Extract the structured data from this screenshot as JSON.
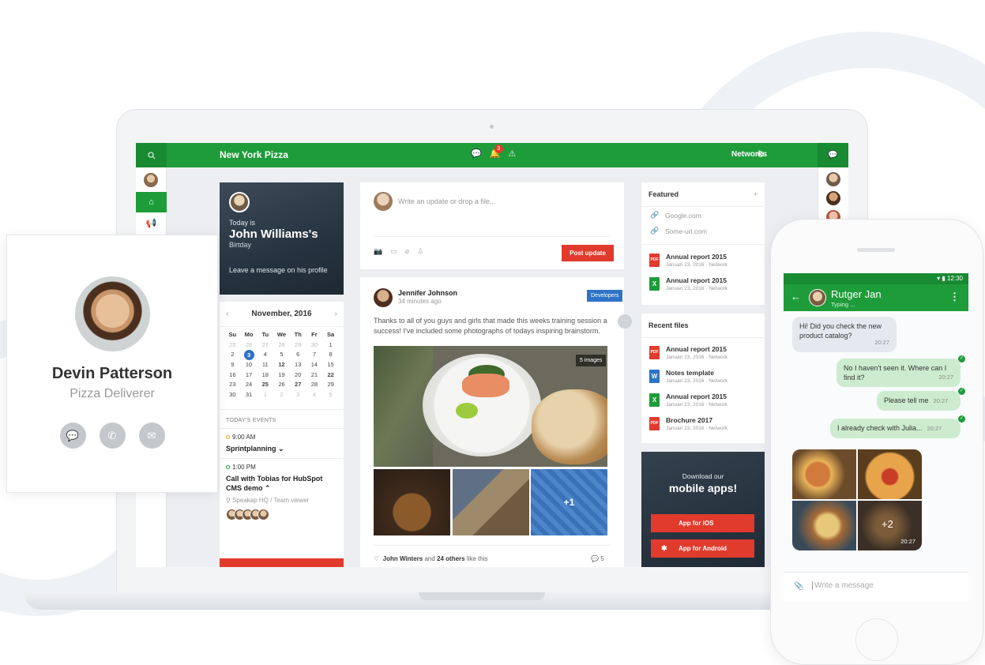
{
  "app": {
    "title": "New York Pizza",
    "notification_count": "3",
    "networks_label": "Networks"
  },
  "birthday": {
    "today_is": "Today is",
    "name": "John Williams's",
    "occasion": "Birtday",
    "cta": "Leave a message on his profile"
  },
  "calendar": {
    "month": "November, 2016",
    "weekdays": [
      "Su",
      "Mo",
      "Tu",
      "We",
      "Th",
      "Fr",
      "Sa"
    ],
    "weeks": [
      [
        "25",
        "26",
        "27",
        "28",
        "29",
        "30",
        "1"
      ],
      [
        "2",
        "3",
        "4",
        "5",
        "6",
        "7",
        "8"
      ],
      [
        "9",
        "10",
        "11",
        "12",
        "13",
        "14",
        "15"
      ],
      [
        "16",
        "17",
        "18",
        "19",
        "20",
        "21",
        "22"
      ],
      [
        "23",
        "24",
        "25",
        "26",
        "27",
        "28",
        "29"
      ],
      [
        "30",
        "31",
        "1",
        "2",
        "3",
        "4",
        "5"
      ]
    ],
    "selected_day": "3"
  },
  "events": {
    "heading": "TODAY'S EVENTS",
    "items": [
      {
        "time": "9:00 AM",
        "title": "Sprintplanning ⌄"
      },
      {
        "time": "1:00 PM",
        "title": "Call with Tobias for HubSpot CMS demo ⌃",
        "location": "Speakap HQ / Team viewer"
      }
    ]
  },
  "composer": {
    "placeholder": "Write an update or drop a file...",
    "post_label": "Post update"
  },
  "post": {
    "author": "Jennifer Johnson",
    "time": "34 minutes ago",
    "badge": "Developers",
    "text": "Thanks to all of you guys and girls that made this weeks training session a success! I've included some photographs of todays inspiring brainstorm.",
    "image_count": "5 images",
    "more_images": "+1",
    "like_name": "John Winters",
    "like_mid": " and ",
    "like_others": "24 others",
    "like_suffix": " like this",
    "comments": "5"
  },
  "featured": {
    "title": "Featured",
    "links": [
      "Google.com",
      "Some-url.com"
    ],
    "files": [
      {
        "name": "Annual report 2015",
        "meta": "Januari 23, 2016 · Network",
        "type": "PDF",
        "color": "#e03b2d"
      },
      {
        "name": "Annual report 2015",
        "meta": "Januari 23, 2016 · Network",
        "type": "X",
        "color": "#1e9c3a"
      }
    ]
  },
  "recent": {
    "title": "Recent files",
    "files": [
      {
        "name": "Annual report 2015",
        "meta": "Januari 23, 2016 · Network",
        "type": "PDF",
        "color": "#e03b2d"
      },
      {
        "name": "Notes template",
        "meta": "Januari 23, 2016 · Network",
        "type": "W",
        "color": "#2f73c6"
      },
      {
        "name": "Annual report 2015",
        "meta": "Januari 23, 2016 · Network",
        "type": "X",
        "color": "#1e9c3a"
      },
      {
        "name": "Brochure 2017",
        "meta": "Januari 23, 2016 · Network",
        "type": "PDF",
        "color": "#e03b2d"
      }
    ]
  },
  "apps": {
    "line1": "Download our",
    "line2": "mobile apps!",
    "ios": "App for iOS",
    "android": "App for Android"
  },
  "profile": {
    "name": "Devin Patterson",
    "role": "Pizza Deliverer"
  },
  "chat": {
    "status_time": "12:30",
    "contact": "Rutger Jan",
    "typing": "Typing ...",
    "messages": [
      {
        "text": "Hi! Did you check the new product catalog?",
        "time": "20:27"
      },
      {
        "text": "No I haven't seen it. Where can I find it?",
        "time": "20:27"
      },
      {
        "text": "Please tell me",
        "time": "20:27"
      },
      {
        "text": "I already check with Julia...",
        "time": "20:27"
      }
    ],
    "photos_more": "+2",
    "photos_time": "20:27",
    "input_placeholder": "Write a message"
  },
  "colors": {
    "brand_green": "#1e9c3a",
    "accent_red": "#e03b2d",
    "accent_blue": "#2f73c6"
  }
}
